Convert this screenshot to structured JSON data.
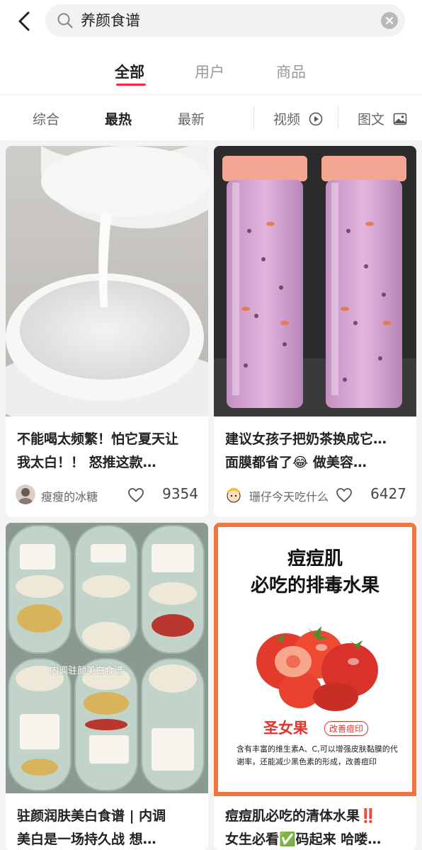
{
  "search": {
    "query": "养颜食谱"
  },
  "top_tabs": [
    {
      "label": "全部",
      "active": true
    },
    {
      "label": "用户",
      "active": false
    },
    {
      "label": "商品",
      "active": false
    }
  ],
  "filters": {
    "sort": [
      {
        "label": "综合",
        "active": false
      },
      {
        "label": "最热",
        "active": true
      },
      {
        "label": "最新",
        "active": false
      }
    ],
    "video_label": "视频",
    "image_text_label": "图文"
  },
  "notes": [
    {
      "title": "不能喝太频繁！怕它夏天让\n我太白！！ 怒推这款…",
      "author": "瘦瘦的冰糖",
      "likes": "9354"
    },
    {
      "title": "建议女孩子把奶茶换成它…\n面膜都省了😂 做美容…",
      "author": "珊仔今天吃什么",
      "likes": "6427"
    },
    {
      "title": "驻颜润肤美白食谱 | 内调\n美白是一场持久战 想…",
      "overlay": "内调驻颜美白食谱"
    },
    {
      "title": "痘痘肌必吃的清体水果‼️\n女生必看✅码起来 哈喽…",
      "poster": {
        "heading_line1": "痘痘肌",
        "heading_line2": "必吃的排毒水果",
        "fruit_name": "圣女果",
        "fruit_tag": "改善痘印",
        "description": "含有丰富的维生素A、C,可以增强皮肤黏膜的代谢率，还能减少黑色素的形成，改善痘印"
      }
    }
  ],
  "colors": {
    "accent": "#ff2442",
    "poster_border": "#f2743f",
    "poster_red": "#e0342d"
  }
}
